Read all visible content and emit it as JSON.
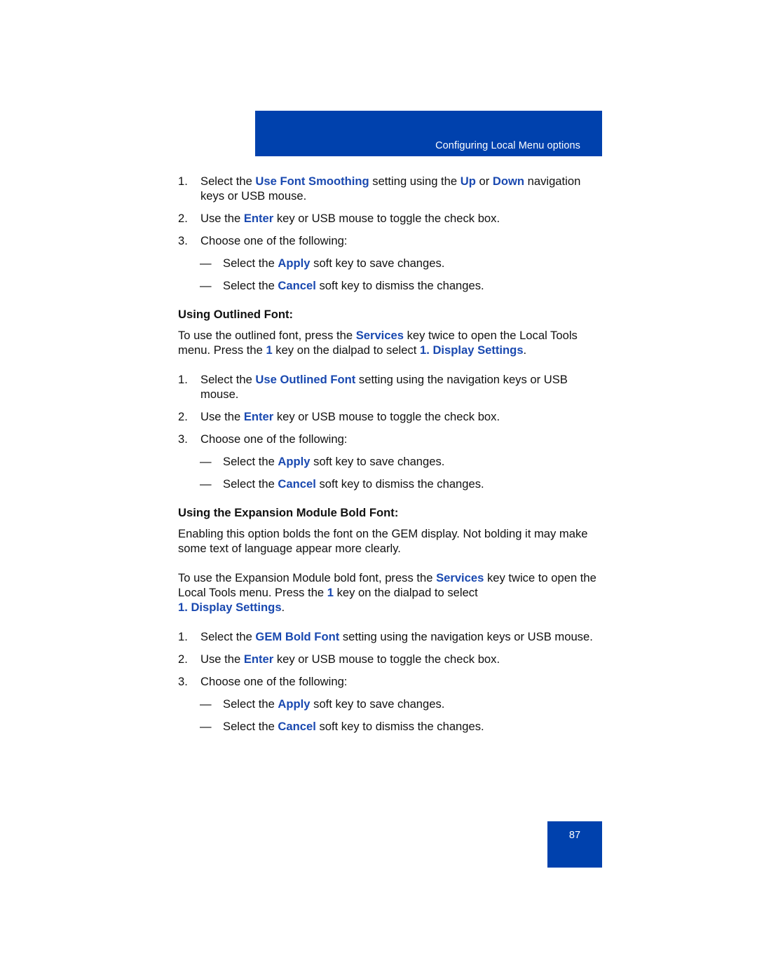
{
  "header": {
    "title": "Configuring Local Menu options"
  },
  "section1": {
    "steps": [
      {
        "num": "1.",
        "t1": "Select the ",
        "k1": "Use Font Smoothing",
        "t2": " setting using the ",
        "k2": "Up",
        "t3": " or ",
        "k3": "Down",
        "t4": " navigation keys or USB mouse."
      },
      {
        "num": "2.",
        "t1": "Use the ",
        "k1": "Enter",
        "t2": " key or USB mouse to toggle the check box."
      },
      {
        "num": "3.",
        "t1": "Choose one of the following:"
      }
    ],
    "subs": [
      {
        "dash": "—",
        "t1": "Select the ",
        "k1": "Apply",
        "t2": " soft key to save changes."
      },
      {
        "dash": "—",
        "t1": "Select the ",
        "k1": "Cancel",
        "t2": " soft key to dismiss the changes."
      }
    ]
  },
  "section2": {
    "heading": "Using Outlined Font:",
    "intro": {
      "t1": "To use the outlined font, press the ",
      "k1": "Services",
      "t2": " key twice to open the Local Tools menu. Press the ",
      "k2": "1",
      "t3": " key on the dialpad to select ",
      "k3": "1. Display Settings",
      "t4": "."
    },
    "steps": [
      {
        "num": "1.",
        "t1": "Select the ",
        "k1": "Use Outlined Font",
        "t2": " setting using the navigation keys or USB mouse."
      },
      {
        "num": "2.",
        "t1": "Use the ",
        "k1": "Enter",
        "t2": " key or USB mouse to toggle the check box."
      },
      {
        "num": "3.",
        "t1": "Choose one of the following:"
      }
    ],
    "subs": [
      {
        "dash": "—",
        "t1": "Select the ",
        "k1": "Apply",
        "t2": " soft key to save changes."
      },
      {
        "dash": "—",
        "t1": "Select the ",
        "k1": "Cancel",
        "t2": " soft key to dismiss the changes."
      }
    ]
  },
  "section3": {
    "heading": "Using the Expansion Module Bold Font:",
    "desc": "Enabling this option bolds the font on the GEM display. Not bolding it may make some text of language appear more clearly.",
    "intro": {
      "t1": "To use the Expansion Module bold font, press the ",
      "k1": "Services",
      "t2": " key twice to open the Local Tools menu. Press the ",
      "k2": "1",
      "t3": " key on the dialpad to select ",
      "k3": "1. Display Settings",
      "t4": "."
    },
    "steps": [
      {
        "num": "1.",
        "t1": "Select the ",
        "k1": "GEM Bold Font",
        "t2": " setting using the navigation keys or USB mouse."
      },
      {
        "num": "2.",
        "t1": "Use the ",
        "k1": "Enter",
        "t2": " key or USB mouse to toggle the check box."
      },
      {
        "num": "3.",
        "t1": "Choose one of the following:"
      }
    ],
    "subs": [
      {
        "dash": "—",
        "t1": "Select the ",
        "k1": "Apply",
        "t2": " soft key to save changes."
      },
      {
        "dash": "—",
        "t1": "Select the ",
        "k1": "Cancel",
        "t2": " soft key to dismiss the changes."
      }
    ]
  },
  "footer": {
    "page_number": "87"
  },
  "colors": {
    "brand_blue": "#0041ad",
    "keyword_blue": "#1a49b0"
  }
}
